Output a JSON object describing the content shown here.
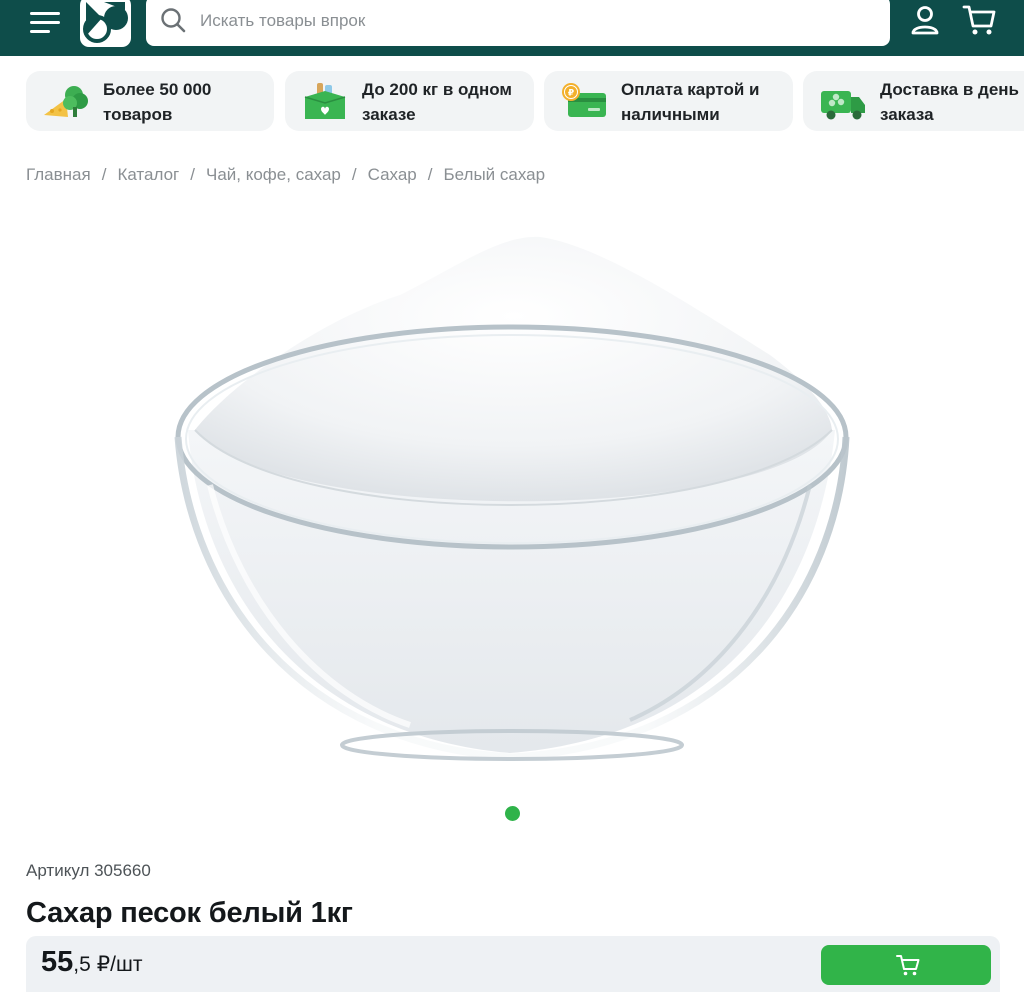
{
  "header": {
    "menu_icon": "hamburger-menu-icon",
    "logo_icon": "brand-logo-icon",
    "search": {
      "placeholder": "Искать товары впрок",
      "value": ""
    },
    "profile_icon": "user-icon",
    "cart_icon": "cart-icon",
    "background_color": "#0e4d4a"
  },
  "features": [
    {
      "icon": "vegetables-icon",
      "text": "Более 50 000\nтоваров"
    },
    {
      "icon": "grocery-box-icon",
      "text": "До 200 кг в одном\nзаказе"
    },
    {
      "icon": "card-payment-icon",
      "text": "Оплата картой и\nналичными"
    },
    {
      "icon": "delivery-truck-icon",
      "text": "Доставка в день\nзаказа"
    }
  ],
  "breadcrumb": {
    "items": [
      "Главная",
      "Каталог",
      "Чай, кофе, сахар",
      "Сахар",
      "Белый сахар"
    ],
    "separator": "/"
  },
  "product": {
    "image": "sugar-bowl-image",
    "article": "Артикул 305660",
    "title": "Сахар песок белый 1кг",
    "price_main": "55",
    "price_fraction": ",5",
    "price_unit": "₽/шт",
    "add_to_cart_icon": "cart-icon"
  },
  "carousel": {
    "current": 1,
    "total": 1
  },
  "colors": {
    "accent_green": "#31b449",
    "header_teal": "#0e4d4a",
    "chip_bg": "#f2f4f5"
  }
}
